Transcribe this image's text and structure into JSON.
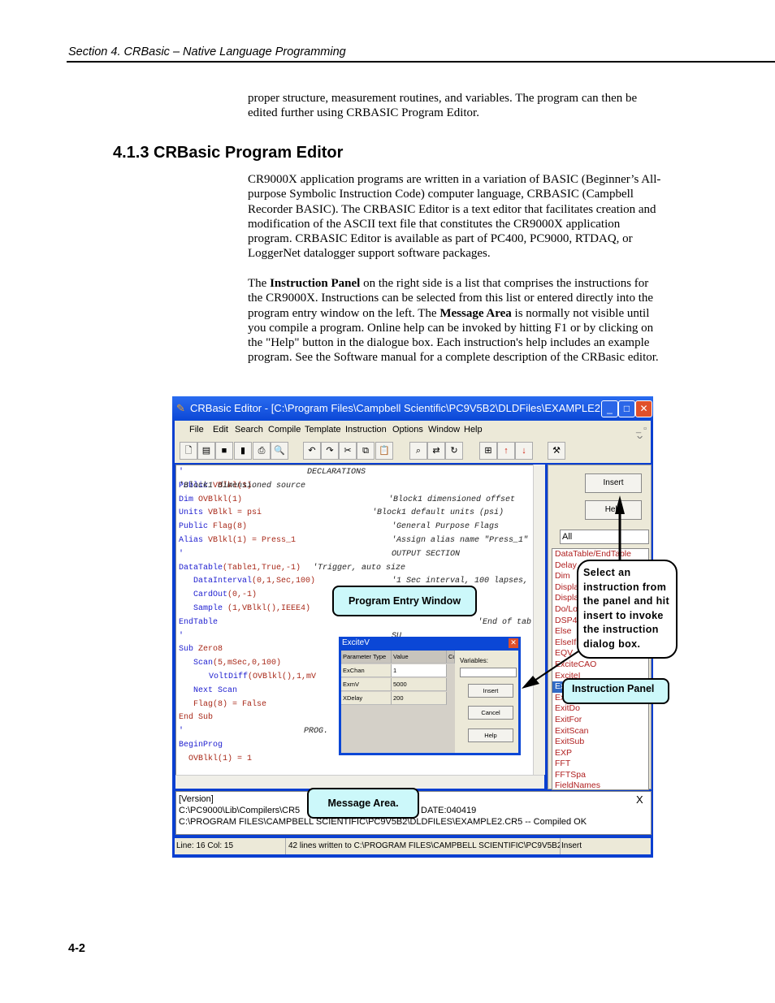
{
  "header": {
    "section": "Section 4.  CRBasic – Native Language Programming"
  },
  "intro": "proper structure, measurement routines, and variables.  The program can then be edited further using CRBASIC Program Editor.",
  "heading": "4.1.3  CRBasic Program Editor",
  "para1": "CR9000X application programs are written in a variation of BASIC (Beginner’s All-purpose Symbolic Instruction Code) computer language, CRBASIC (Campbell Recorder BASIC). The CRBASIC Editor is a text editor that facilitates creation and modification of the ASCII text file that constitutes the CR9000X application program.  CRBASIC Editor is available as part of PC400, PC9000, RTDAQ, or LoggerNet datalogger support software packages.",
  "para2": {
    "s1": "The ",
    "b1": "Instruction Panel",
    "s2": " on the right side is a list that comprises the instructions for the CR9000X.  Instructions can be selected from this list or entered directly into the program entry window on the left.  The ",
    "b2": "Message Area",
    "s3": " is normally not visible until you compile a program.  Online help can be invoked by hitting F1 or by clicking on the \"Help\" button in the dialogue box. Each instruction's help includes an example program. See the Software manual for a complete description of the CRBasic editor."
  },
  "page_number": "4-2",
  "editor": {
    "title": "CRBasic Editor - [C:\\Program Files\\Campbell Scientific\\PC9V5B2\\DLDFiles\\EXAMPLE2.C...",
    "menu": [
      "File",
      "Edit",
      "Search",
      "Compile",
      "Template",
      "Instruction",
      "Options",
      "Window",
      "Help"
    ],
    "toolbar_icons": [
      "new-icon",
      "open-icon",
      "save-icon",
      "save-compile-icon",
      "print-icon",
      "print-preview-icon",
      "undo-icon",
      "redo-icon",
      "cut-icon",
      "copy-icon",
      "paste-icon",
      "find-icon",
      "replace-icon",
      "find-next-icon",
      "compile-icon",
      "up-icon",
      "down-icon",
      "tools-icon"
    ],
    "code": [
      {
        "kw": "'",
        "ar": "",
        "cm": "DECLARATIONS"
      },
      {
        "kw": "Public",
        "ar": " VBlkl(1)",
        "cm": "'Block1 dimensioned source"
      },
      {
        "kw": "Dim",
        "ar": " OVBlkl(1)",
        "cm": "'Block1 dimensioned offset"
      },
      {
        "kw": "Units",
        "ar": " VBlkl = psi",
        "cm": "'Block1 default units (psi)"
      },
      {
        "kw": "Public",
        "ar": " Flag(8)",
        "cm": "'General Purpose Flags"
      },
      {
        "kw": "Alias",
        "ar": " VBlkl(1) = Press_1",
        "cm": "'Assign alias name \"Press_1\""
      },
      {
        "kw": "'",
        "ar": "",
        "cm": "OUTPUT SECTION"
      },
      {
        "kw": "DataTable",
        "ar": "(Table1,True,-1)",
        "cm": "'Trigger, auto size"
      },
      {
        "kw": "DataInterval",
        "ar": "(0,1,Sec,100)",
        "cm": "'1 Sec interval, 100 lapses,"
      },
      {
        "kw": "CardOut",
        "ar": "(0,-1)",
        "cm": "uto"
      },
      {
        "kw": "Sample",
        "ar": " (1,VBlkl(),IEEE4)",
        "cm": ""
      },
      {
        "kw": "EndTable",
        "ar": "",
        "cm": "'End of table Table1"
      },
      {
        "kw": "'",
        "ar": "",
        "cm": "SU"
      },
      {
        "kw": "Sub",
        "ar": " Zero8",
        "cm": ""
      },
      {
        "kw": "Scan",
        "ar": "(5,mSec,0,100)",
        "cm": ""
      },
      {
        "kw": "VoltDiff",
        "ar": "(OVBlkl(),1,mV",
        "cm": ""
      },
      {
        "kw": "Next Scan",
        "ar": "",
        "cm": ""
      },
      {
        "kw": "",
        "ar": "Flag(8) = False",
        "cm": ""
      },
      {
        "kw": "",
        "ar": "End Sub",
        "cm": ""
      },
      {
        "kw": "'",
        "ar": "",
        "cm": "PROG."
      },
      {
        "kw": "BeginProg",
        "ar": "",
        "cm": ""
      },
      {
        "kw": "",
        "ar": "OVBlkl(1) = 1",
        "cm": ""
      }
    ],
    "panel": {
      "insert": "Insert",
      "help": "Help",
      "filter": "All",
      "items": [
        "DataTable/EndTable",
        "Delay",
        "Dim",
        "Display",
        "Display",
        "Do/Lo",
        "DSP4",
        "Else",
        "ElseIf",
        "EQV",
        "ExciteCAO",
        "ExciteI",
        "ExciteV",
        "Ex",
        "ExitDo",
        "ExitFor",
        "ExitScan",
        "ExitSub",
        "EXP",
        "FFT",
        "FFTSpa",
        "FieldNames"
      ],
      "selected_index": 12
    },
    "dialog": {
      "title": "ExciteV",
      "col1": "Parameter Type",
      "col2": "Value",
      "col3": "Co",
      "variables": "Variables:",
      "rows": [
        {
          "p": "ExChan",
          "v": "1"
        },
        {
          "p": "ExmV",
          "v": "5000"
        },
        {
          "p": "XDelay",
          "v": "200"
        }
      ],
      "insert": "Insert",
      "cancel": "Cancel",
      "help": "Help"
    },
    "messages": {
      "l1": "[Version]",
      "l2a": "C:\\PC9000\\Lib\\Compilers\\CR5",
      "l2b": "DATE:040419",
      "l3": "C:\\PROGRAM FILES\\CAMPBELL SCIENTIFIC\\PC9V5B2\\DLDFILES\\EXAMPLE2.CR5 -- Compiled OK",
      "close": "X"
    },
    "status": {
      "pos": "Line: 16 Col: 15",
      "info": "42 lines written to C:\\PROGRAM FILES\\CAMPBELL SCIENTIFIC\\PC9V5B2\\DLD",
      "mode": "Insert"
    }
  },
  "callouts": {
    "entry": "Program Entry Window",
    "message": "Message Area.",
    "panel": "Instruction Panel",
    "bubble": "Select an instruction from the panel and hit insert to invoke the instruction dialog box."
  }
}
